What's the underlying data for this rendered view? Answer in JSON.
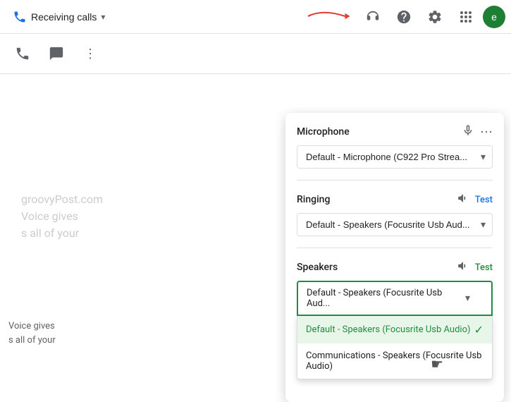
{
  "header": {
    "receiving_calls_label": "Receiving calls",
    "avatar_letter": "e"
  },
  "sub_toolbar": {
    "phone_icon": "☎",
    "message_icon": "💬",
    "more_icon": "⋮"
  },
  "watermark": {
    "line1": "groovyPost.com",
    "line2": "Voice gives",
    "line3": "s all of your"
  },
  "dropdown": {
    "microphone_section": {
      "title": "Microphone",
      "selected": "Default - Microphone (C922 Pro Strea...",
      "mic_icon": "🎤",
      "more_icon": "⋯"
    },
    "ringing_section": {
      "title": "Ringing",
      "test_label": "Test",
      "selected": "Default - Speakers (Focusrite Usb Aud..."
    },
    "speakers_section": {
      "title": "Speakers",
      "test_label": "Test",
      "selected": "Default - Speakers (Focusrite Usb Aud...",
      "options": [
        {
          "label": "Default - Speakers (Focusrite Usb Audio)",
          "selected": true
        },
        {
          "label": "Communications - Speakers (Focusrite Usb Audio)",
          "selected": false
        }
      ]
    }
  },
  "footer": {
    "line1": "Voice gives",
    "line2": "s all of your"
  }
}
